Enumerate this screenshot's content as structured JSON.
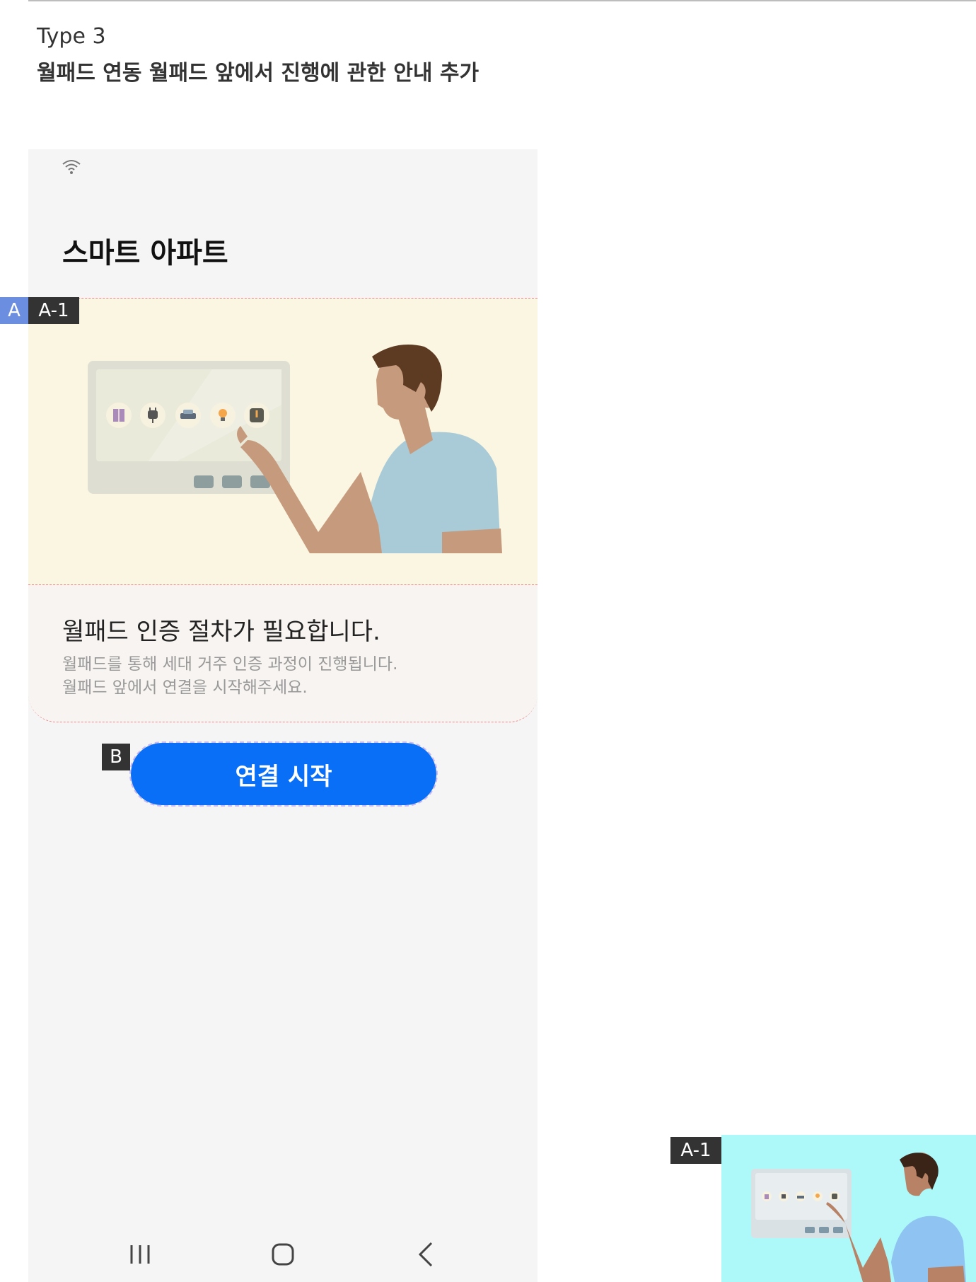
{
  "doc": {
    "type_label": "Type 3",
    "description": "월패드 연동 월패드 앞에서 진행에 관한 안내 추가"
  },
  "status_bar": {
    "icon": "wifi-icon"
  },
  "app": {
    "title": "스마트 아파트"
  },
  "card": {
    "heading": "월패드 인증 절차가 필요합니다.",
    "body_line1": "월패드를 통해 세대 거주 인증 과정이 진행됩니다.",
    "body_line2": "월패드 앞에서 연결을 시작해주세요.",
    "illustration_icons": [
      "elevator-icon",
      "plug-icon",
      "car-icon",
      "bulb-icon",
      "thermometer-icon"
    ]
  },
  "cta": {
    "label": "연결 시작"
  },
  "nav": {
    "icons": [
      "recents-icon",
      "home-icon",
      "back-icon"
    ]
  },
  "annotations": {
    "a": "A",
    "a1": "A-1",
    "b": "B",
    "a1_thumb": "A-1"
  },
  "colors": {
    "primary": "#0a6ff7",
    "illustration_bg": "#fbf6e1",
    "thumb_bg": "#adf8f9",
    "tag_blue": "#6b8ee0",
    "tag_dark": "#333333"
  }
}
